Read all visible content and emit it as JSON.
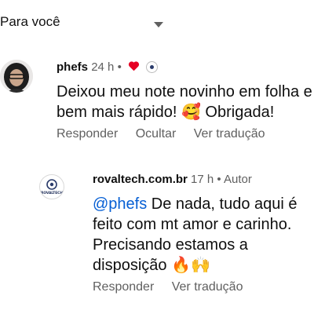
{
  "filter": {
    "label": "Para você"
  },
  "comments": [
    {
      "author": "phefs",
      "time": "24 h",
      "dot": "•",
      "text": "Deixou meu note novinho em folha e bem mais rápido! 🥰 Obrigada!",
      "actions": {
        "reply": "Responder",
        "hide": "Ocultar",
        "translate": "Ver tradução"
      }
    },
    {
      "author": "rovaltech.com.br",
      "time": "17 h",
      "dot": "•",
      "role": "Autor",
      "logo_text": "ROVALTECH",
      "mention": "@phefs",
      "text": " De nada, tudo aqui é feito com mt amor e carinho. Precisando estamos a disposição 🔥🙌",
      "actions": {
        "reply": "Responder",
        "translate": "Ver tradução"
      }
    }
  ],
  "colors": {
    "heart": "#e60023",
    "mention": "#065fd4",
    "muted": "#606060"
  }
}
